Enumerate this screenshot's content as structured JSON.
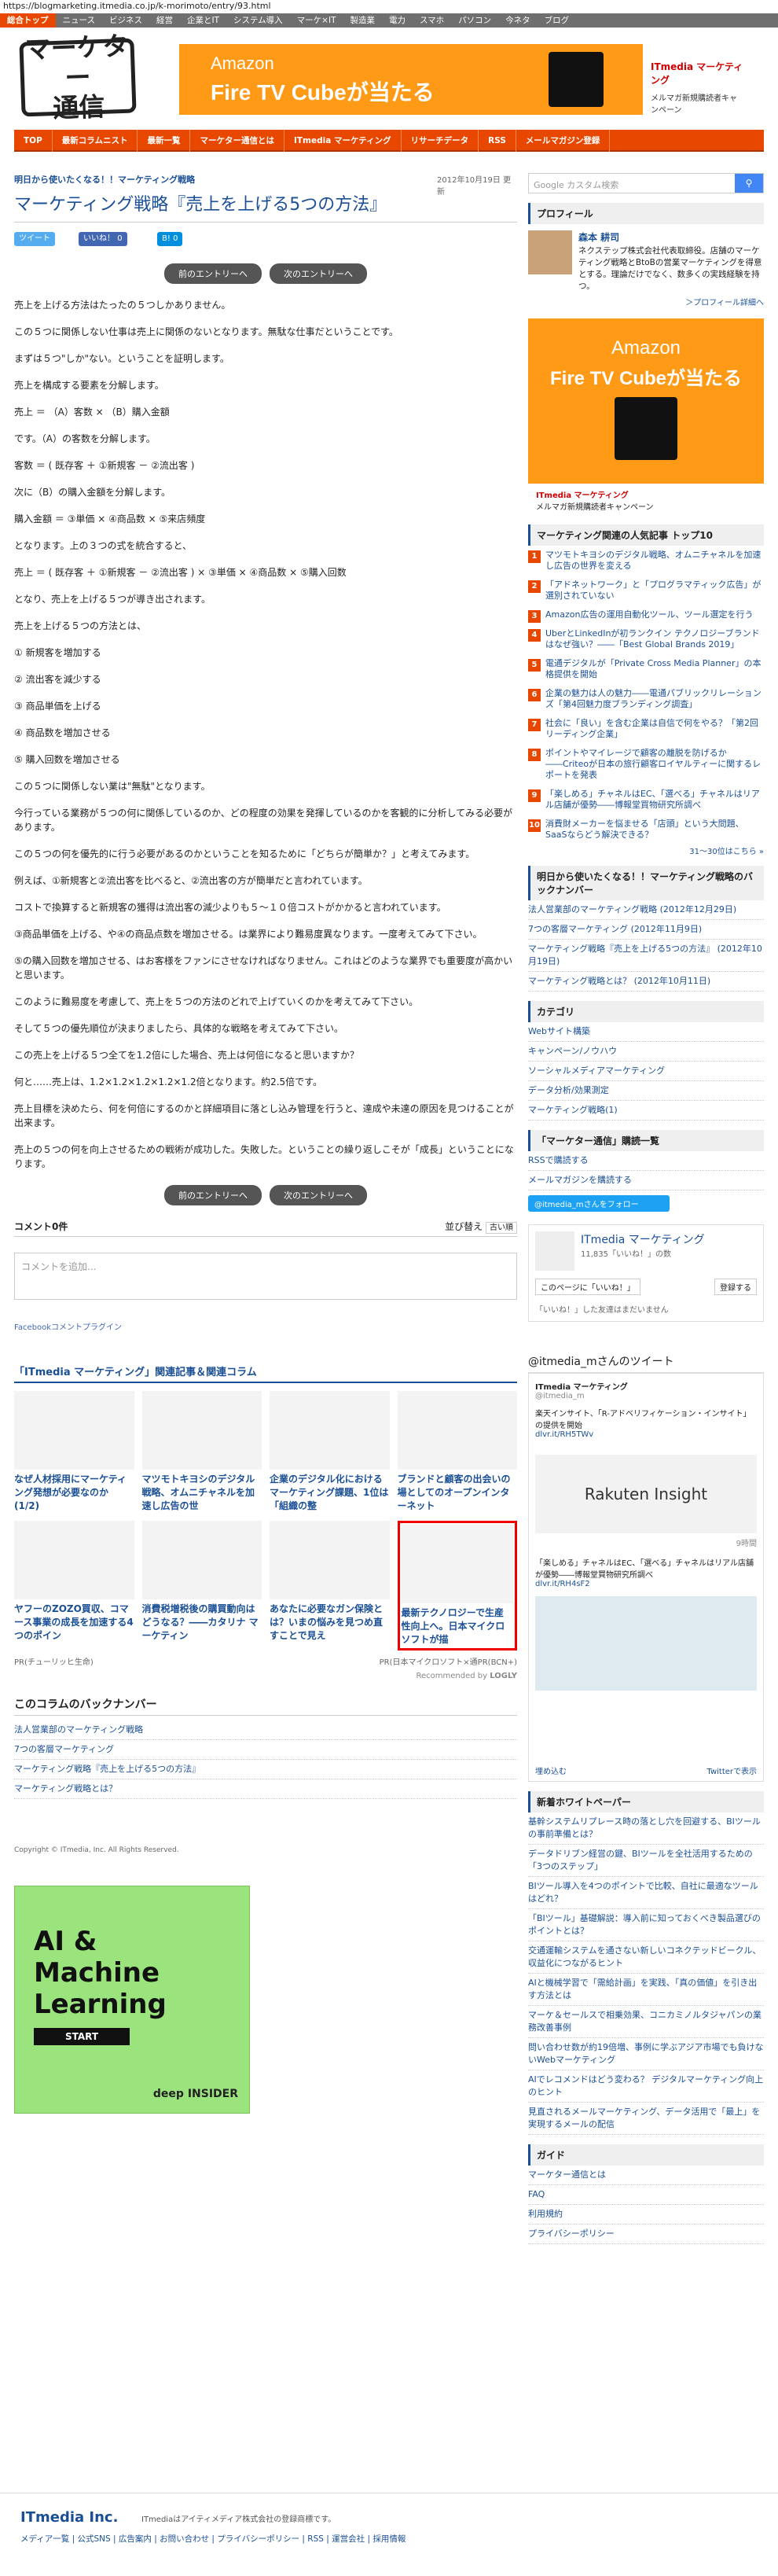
{
  "url": "https://blogmarketing.itmedia.co.jp/k-morimoto/entry/93.html",
  "topnav": [
    "総合トップ",
    "ニュース",
    "ビジネス",
    "経営",
    "企業とIT",
    "システム導入",
    "マーケ×IT",
    "製造業",
    "電力",
    "スマホ",
    "パソコン",
    "今ネタ",
    "ブログ"
  ],
  "logo": "マーケター通信",
  "ad_top": {
    "line1": "Amazon",
    "line2": "Fire TV Cubeが当たる",
    "brand": "ITmedia マーケティング",
    "sub": "メルマガ新規購読者キャンペーン"
  },
  "subnav": [
    "TOP",
    "最新コラムニスト",
    "最新一覧",
    "マーケター通信とは",
    "ITmedia マーケティング",
    "リサーチデータ",
    "RSS",
    "メールマガジン登録"
  ],
  "article": {
    "kicker": "明日から使いたくなる！！マーケティング戦略",
    "date": "2012年10月19日 更新",
    "title": "マーケティング戦略『売上を上げる5つの方法』",
    "share": {
      "tweet": "ツイート",
      "like": "いいね！",
      "like_count": "0",
      "hatena": "B!",
      "hatena_count": "0"
    },
    "prev": "前のエントリーへ",
    "next": "次のエントリーへ",
    "paragraphs": [
      "売上を上げる方法はたったの５つしかありません。",
      "この５つに関係しない仕事は売上に関係のないとなります。無駄な仕事だということです。",
      "まずは５つ\"しか\"ない。ということを証明します。",
      "売上を構成する要素を分解します。",
      "売上 ＝ （A）客数 × （B）購入金額",
      "です。（A）の客数を分解します。",
      "客数 ＝ ( 既存客 ＋ ①新規客 － ②流出客 )",
      "次に（B）の購入金額を分解します。",
      "購入金額 ＝ ③単価 × ④商品数 × ⑤来店頻度",
      "となります。上の３つの式を統合すると、",
      "売上 ＝ ( 既存客 ＋ ①新規客 － ②流出客 ) × ③単価 × ④商品数 × ⑤購入回数",
      "となり、売上を上げる５つが導き出されます。",
      "売上を上げる５つの方法とは、",
      "① 新規客を増加する",
      "② 流出客を減少する",
      "③ 商品単価を上げる",
      "④ 商品数を増加させる",
      "⑤ 購入回数を増加させる",
      "この５つに関係しない業は\"無駄\"となります。",
      "今行っている業務が５つの何に関係しているのか、どの程度の効果を発揮しているのかを客観的に分析してみる必要があります。",
      "この５つの何を優先的に行う必要があるのかということを知るために「どちらが簡単か？」と考えてみます。",
      "例えば、①新規客と②流出客を比べると、②流出客の方が簡単だと言われています。",
      "コストで換算すると新規客の獲得は流出客の減少よりも５～１０倍コストがかかると言われています。",
      "③商品単価を上げる、や④の商品点数を増加させる。は業界により難易度異なります。一度考えてみて下さい。",
      "⑤の購入回数を増加させる、はお客様をファンにさせなければなりません。これはどのような業界でも重要度が高かいと思います。",
      "このように難易度を考慮して、売上を５つの方法のどれで上げていくのかを考えてみて下さい。",
      "そして５つの優先順位が決まりましたら、具体的な戦略を考えてみて下さい。",
      "この売上を上げる５つ全てを1.2倍にした場合、売上は何倍になると思いますか？",
      "何と……売上は、1.2×1.2×1.2×1.2×1.2倍となります。約2.5倍です。",
      "売上目標を決めたら、何を何倍にするのかと詳細項目に落とし込み管理を行うと、達成や未達の原因を見つけることが出来ます。",
      "売上の５つの何を向上させるための戦術が成功した。失敗した。ということの繰り返しこそが「成長」ということになります。"
    ],
    "comments_label": "コメント0件",
    "sort_label": "並び替え",
    "sort_value": "古い順",
    "comment_placeholder": "コメントを追加...",
    "fb_plugin": "Facebookコメントプラグイン"
  },
  "related": {
    "title": "「ITmedia マーケティング」関連記事＆関連コラム",
    "items": [
      "なぜ人材採用にマーケティング発想が必要なのか (1/2)",
      "マツモトキヨシのデジタル戦略、オムニチャネルを加速し広告の世",
      "企業のデジタル化におけるマーケティング課題、1位は「組織の整",
      "ブランドと顧客の出会いの場としてのオープンインターネット",
      "ヤフーのZOZO買収、コマース事業の成長を加速する4つのポイン",
      "消費税増税後の購買動向はどうなる？――カタリナ マーケティン",
      "あなたに必要なガン保険とは？いまの悩みを見つめ直すことで見え",
      "最新テクノロジーで生産性向上へ。日本マイクロソフトが描"
    ],
    "pr_label": "PR(チューリッヒ生命)",
    "pr2": "PR(日本マイクロソフト×通PR(BCN+)",
    "recommended": "Recommended by",
    "logly": "LOGLY"
  },
  "backnumber": {
    "title": "このコラムのバックナンバー",
    "items": [
      "法人営業部のマーケティング戦略",
      "7つの客層マーケティング",
      "マーケティング戦略『売上を上げる5つの方法』",
      "マーケティング戦略とは？"
    ]
  },
  "copyright": "Copyright © ITmedia, Inc. All Rights Reserved.",
  "ad_ai": {
    "line1": "AI &",
    "line2": "Machine",
    "line3": "Learning",
    "start": "START",
    "brand": "deep INSIDER"
  },
  "sidebar": {
    "search_placeholder": "Google カスタム検索",
    "profile_title": "プロフィール",
    "profile_name": "森本 耕司",
    "profile_text": "ネクステップ株式会社代表取締役。店舗のマーケティング戦略とBtoBの営業マーケティングを得意とする。理論だけでなく、数多くの実践経験を持つ。",
    "profile_link": "＞プロフィール詳細へ",
    "ranking_title": "マーケティング関連の人気記事 トップ10",
    "ranking": [
      "マツモトキヨシのデジタル戦略、オムニチャネルを加速し広告の世界を変える",
      "「アドネットワーク」と「プログラマティック広告」が選別されていない",
      "Amazon広告の運用自動化ツール、ツール選定を行う",
      "UberとLinkedInが初ランクイン テクノロジーブランドはなぜ強い？――「Best Global Brands 2019」",
      "電通デジタルが「Private Cross Media Planner」の本格提供を開始",
      "企業の魅力は人の魅力――電通パブリックリレーションズ「第4回魅力度ブランディング調査」",
      "社会に「良い」を含む企業は自信で何をやる？「第2回リーディング企業」",
      "ポイントやマイレージで顧客の離脱を防げるか――Criteoが日本の旅行顧客ロイヤルティーに関するレポートを発表",
      "「楽しめる」チャネルはEC、「選べる」チャネルはリアル店舗が優勢――博報堂買物研究所調べ",
      "消費財メーカーを悩ませる「店頭」という大問題、SaaSならどう解決できる？"
    ],
    "ranking_more": "31～30位はこちら »",
    "series_title": "明日から使いたくなる！！マーケティング戦略のバックナンバー",
    "series": [
      "法人営業部のマーケティング戦略 (2012年12月29日)",
      "7つの客層マーケティング (2012年11月9日)",
      "マーケティング戦略『売上を上げる5つの方法』 (2012年10月19日)",
      "マーケティング戦略とは？ (2012年10月11日)"
    ],
    "category_title": "カテゴリ",
    "categories": [
      "Webサイト構築",
      "キャンペーン/ノウハウ",
      "ソーシャルメディアマーケティング",
      "データ分析/効果測定",
      "マーケティング戦略(1)"
    ],
    "subscribe_title": "「マーケター通信」購読一覧",
    "subscribe": [
      "RSSで購読する",
      "メールマガジンを購読する"
    ],
    "follow": "@itmedia_mさんをフォロー",
    "fb_name": "ITmedia マーケティング",
    "fb_likes": "11,835「いいね！」の数",
    "fb_like_btn": "このページに「いいね！」",
    "fb_signup": "登録する",
    "fb_friends": "「いいね！」した友達はまだいません",
    "tw_title": "@itmedia_mさんのツイート",
    "tw_name": "ITmedia マーケティング",
    "tw_handle": "@itmedia_m",
    "tw_text1": "楽天インサイト、「R-アドベリフィケーション・インサイト」の提供を開始",
    "tw_link1": "dlvr.it/RH5TWv",
    "tw_brand": "Rakuten Insight",
    "tw_time": "9時間",
    "tw_text2": "「楽しめる」チャネルはEC、「選べる」チャネルはリアル店舗が優勢――博報堂買物研究所調べ",
    "tw_link2": "dlvr.it/RH4sF2",
    "tw_embed": "埋め込む",
    "tw_view": "Twitterで表示",
    "wp_title": "新着ホワイトペーパー",
    "whitepapers": [
      "基幹システムリプレース時の落とし穴を回避する、BIツールの事前準備とは？",
      "データドリブン経営の鍵、BIツールを全社活用するための「3つのステップ」",
      "BIツール導入を4つのポイントで比較、自社に最適なツールはどれ？",
      "「BIツール」基礎解説：導入前に知っておくべき製品選びのポイントとは？",
      "交通運輸システムを通さない新しいコネクテッドビークル、収益化につながるヒント",
      "AIと機械学習で「需給計画」を実践、「真の価値」を引き出す方法とは",
      "マーケ＆セールスで相乗効果、コニカミノルタジャパンの業務改善事例",
      "問い合わせ数が約19倍増、事例に学ぶアジア市場でも負けないWebマーケティング",
      "AIでレコメンドはどう変わる？ デジタルマーケティング向上のヒント",
      "見直されるメールマーケティング、データ活用で「最上」を実現するメールの配信"
    ],
    "guide_title": "ガイド",
    "guide": [
      "マーケター通信とは",
      "FAQ",
      "利用規約",
      "プライバシーポリシー"
    ]
  },
  "footer": {
    "brand": "ITmedia Inc.",
    "tagline": "ITmediaはアイティメディア株式会社の登録商標です。",
    "links": "メディア一覧 | 公式SNS | 広告案内 | お問い合わせ | プライバシーポリシー | RSS | 運営会社 | 採用情報"
  },
  "colors": {
    "accent": "#e84700",
    "link": "#1a4f96",
    "ad": "#ff9a17"
  }
}
